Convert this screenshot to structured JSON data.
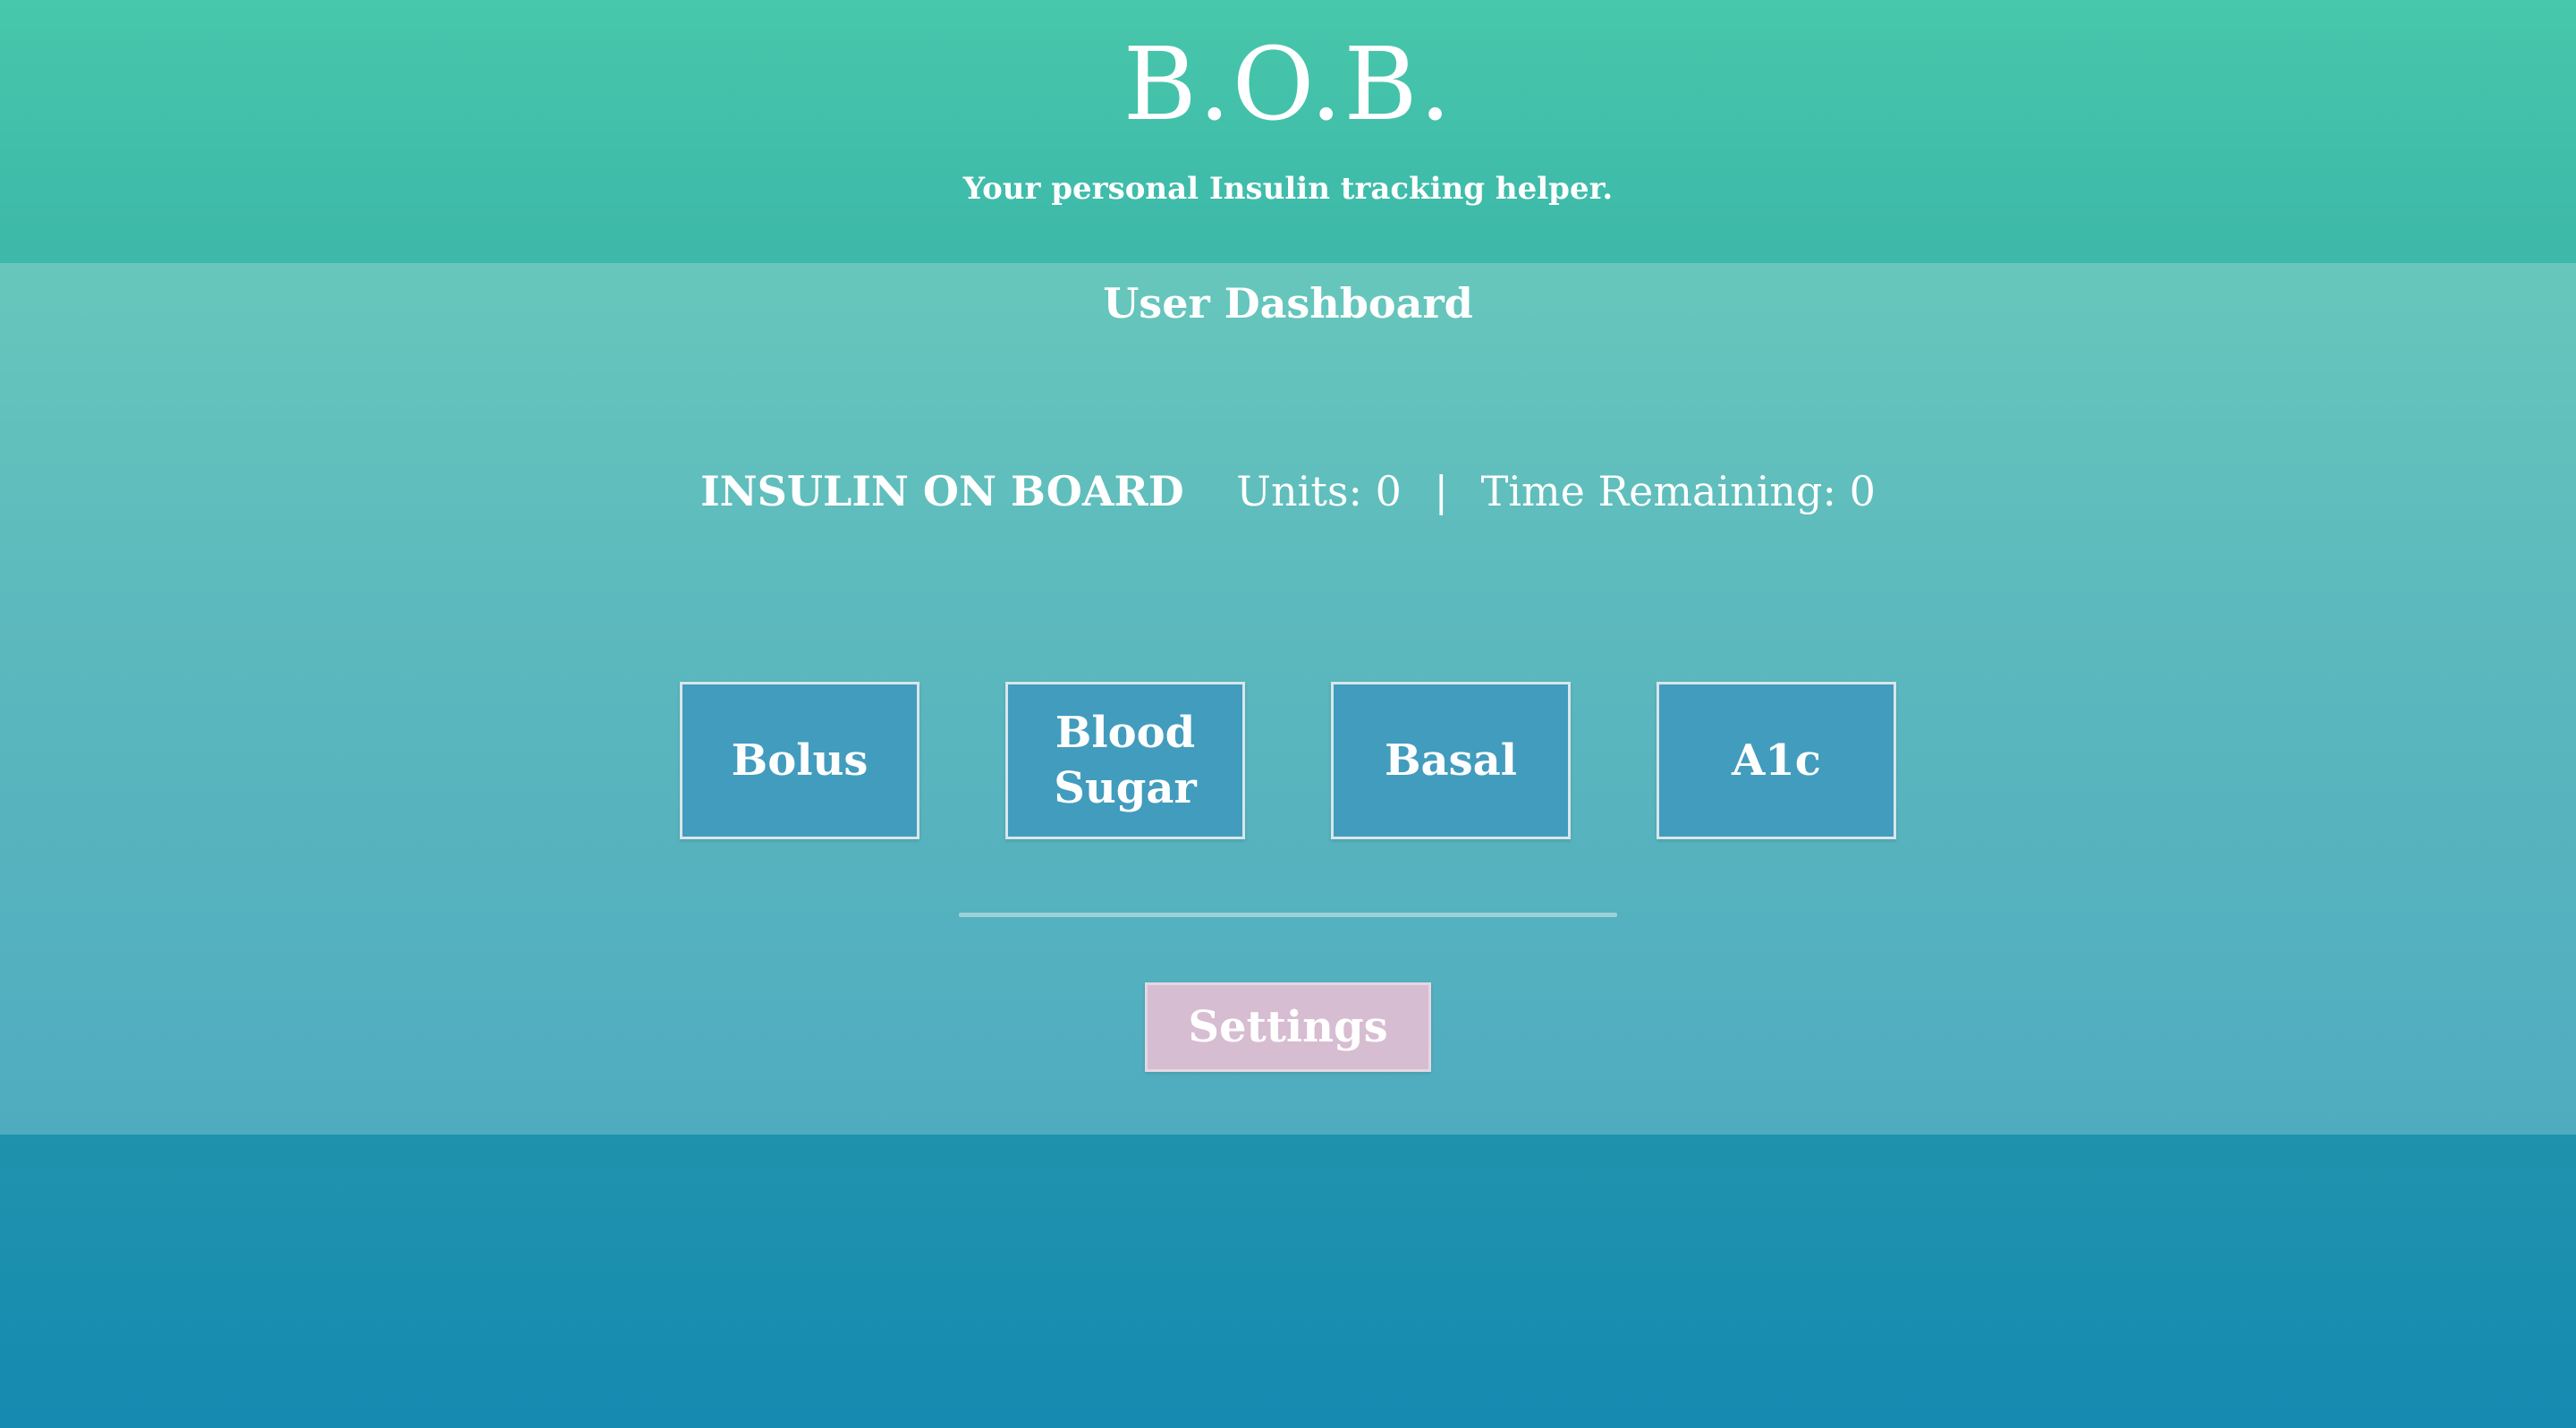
{
  "header": {
    "title": "B.O.B.",
    "tagline": "Your personal Insulin tracking helper."
  },
  "dashboard": {
    "title": "User Dashboard",
    "insulin_on_board": {
      "label": "INSULIN ON BOARD",
      "units_text": "Units: 0",
      "separator": "|",
      "time_remaining_text": "Time Remaining: 0"
    },
    "tiles": [
      {
        "label": "Bolus"
      },
      {
        "label": "Blood Sugar"
      },
      {
        "label": "Basal"
      },
      {
        "label": "A1c"
      }
    ],
    "settings_label": "Settings"
  },
  "colors": {
    "header_top": "#47c7ab",
    "tile_background": "#429cbd",
    "settings_background": "#d7bdd1",
    "footer": "#168ab0"
  }
}
